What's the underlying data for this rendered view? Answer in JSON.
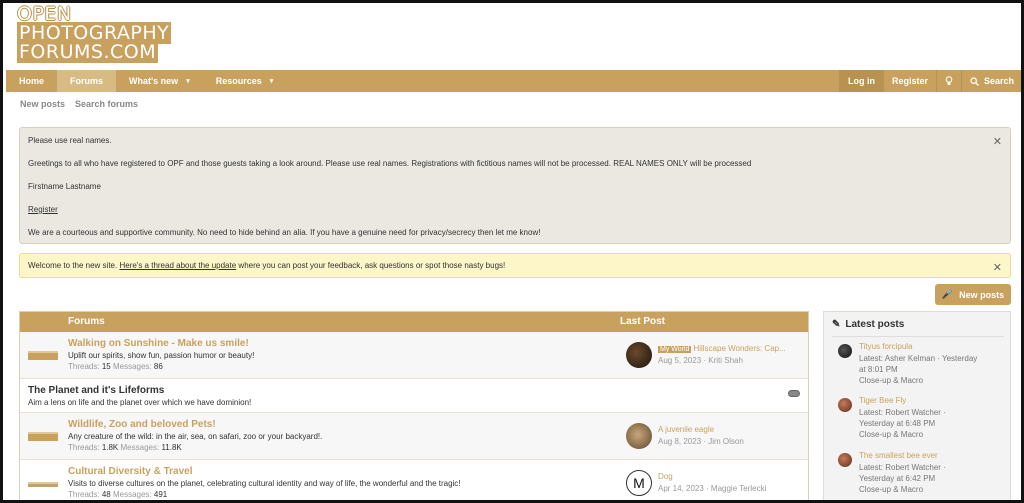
{
  "logo": {
    "line1": "OPEN",
    "line2": "PHOTOGRAPHY",
    "line3": "FORUMS.COM"
  },
  "nav": {
    "home": "Home",
    "forums": "Forums",
    "whats_new": "What's new",
    "resources": "Resources",
    "login": "Log in",
    "register": "Register",
    "search": "Search"
  },
  "subnav": {
    "new_posts": "New posts",
    "search_forums": "Search forums"
  },
  "notice1": {
    "p1": "Please use real names.",
    "p2": "Greetings to all who have registered to OPF and those guests taking a look around. Please use real names. Registrations with fictitious names will not be processed. REAL NAMES ONLY will be processed",
    "p3": "Firstname Lastname",
    "p4": "Register",
    "p5": "We are a courteous and supportive community. No need to hide behind an alia. If you have a genuine need for privacy/secrecy then let me know!"
  },
  "notice2": {
    "pre": "Welcome to the new site. ",
    "link": "Here's a thread about the update",
    "post": " where you can post your feedback, ask questions or spot those nasty bugs!"
  },
  "new_posts_btn": "New posts",
  "forums": {
    "head_forums": "Forums",
    "head_last": "Last Post",
    "rows": [
      {
        "title": "Walking on Sunshine - Make us smile!",
        "desc": "Uplift our spirits, show fun, passion humor or beauty!",
        "threads_label": "Threads:",
        "threads": "15",
        "messages_label": "Messages:",
        "messages": "86",
        "lp_tag": "My World",
        "lp_title": "Hillscape Wonders: Cap...",
        "lp_meta": "Aug 5, 2023 · Kriti Shah"
      },
      {
        "title": "Wildlife, Zoo and beloved Pets!",
        "desc": "Any creature of the wild: in the air, sea, on safari, zoo or your backyard!.",
        "threads_label": "Threads:",
        "threads": "1.8K",
        "messages_label": "Messages:",
        "messages": "11.8K",
        "lp_title": "A juvenile eagle",
        "lp_meta": "Aug 8, 2023 · Jim Olson"
      },
      {
        "title": "Cultural Diversity & Travel",
        "desc": "Visits to diverse cultures on the planet, celebrating cultural identity and way of life, the wonderful and the tragic!",
        "threads_label": "Threads:",
        "threads": "48",
        "messages_label": "Messages:",
        "messages": "491",
        "lp_avatar_letter": "M",
        "lp_title": "Dog",
        "lp_meta": "Apr 14, 2023 · Maggie Terlecki"
      }
    ],
    "category": {
      "title": "The Planet and it's Lifeforms",
      "desc": "Aim a lens on life and the planet over which we have dominion!"
    }
  },
  "sidebar": {
    "title": "Latest posts",
    "posts": [
      {
        "title": "Tityus forcipula",
        "l1": "Latest: Asher Kelman · Yesterday",
        "l2": "at 8:01 PM",
        "l3": "Close-up & Macro"
      },
      {
        "title": "Tiger Bee Fly",
        "l1": "Latest: Robert Watcher ·",
        "l2": "Yesterday at 6:48 PM",
        "l3": "Close-up & Macro"
      },
      {
        "title": "The smallest bee ever",
        "l1": "Latest: Robert Watcher ·",
        "l2": "Yesterday at 6:42 PM",
        "l3": "Close-up & Macro"
      }
    ]
  },
  "colors": {
    "accent": "#c9a15e",
    "notice_bg": "#ebe8e1",
    "banner_bg": "#fdf6c9"
  }
}
